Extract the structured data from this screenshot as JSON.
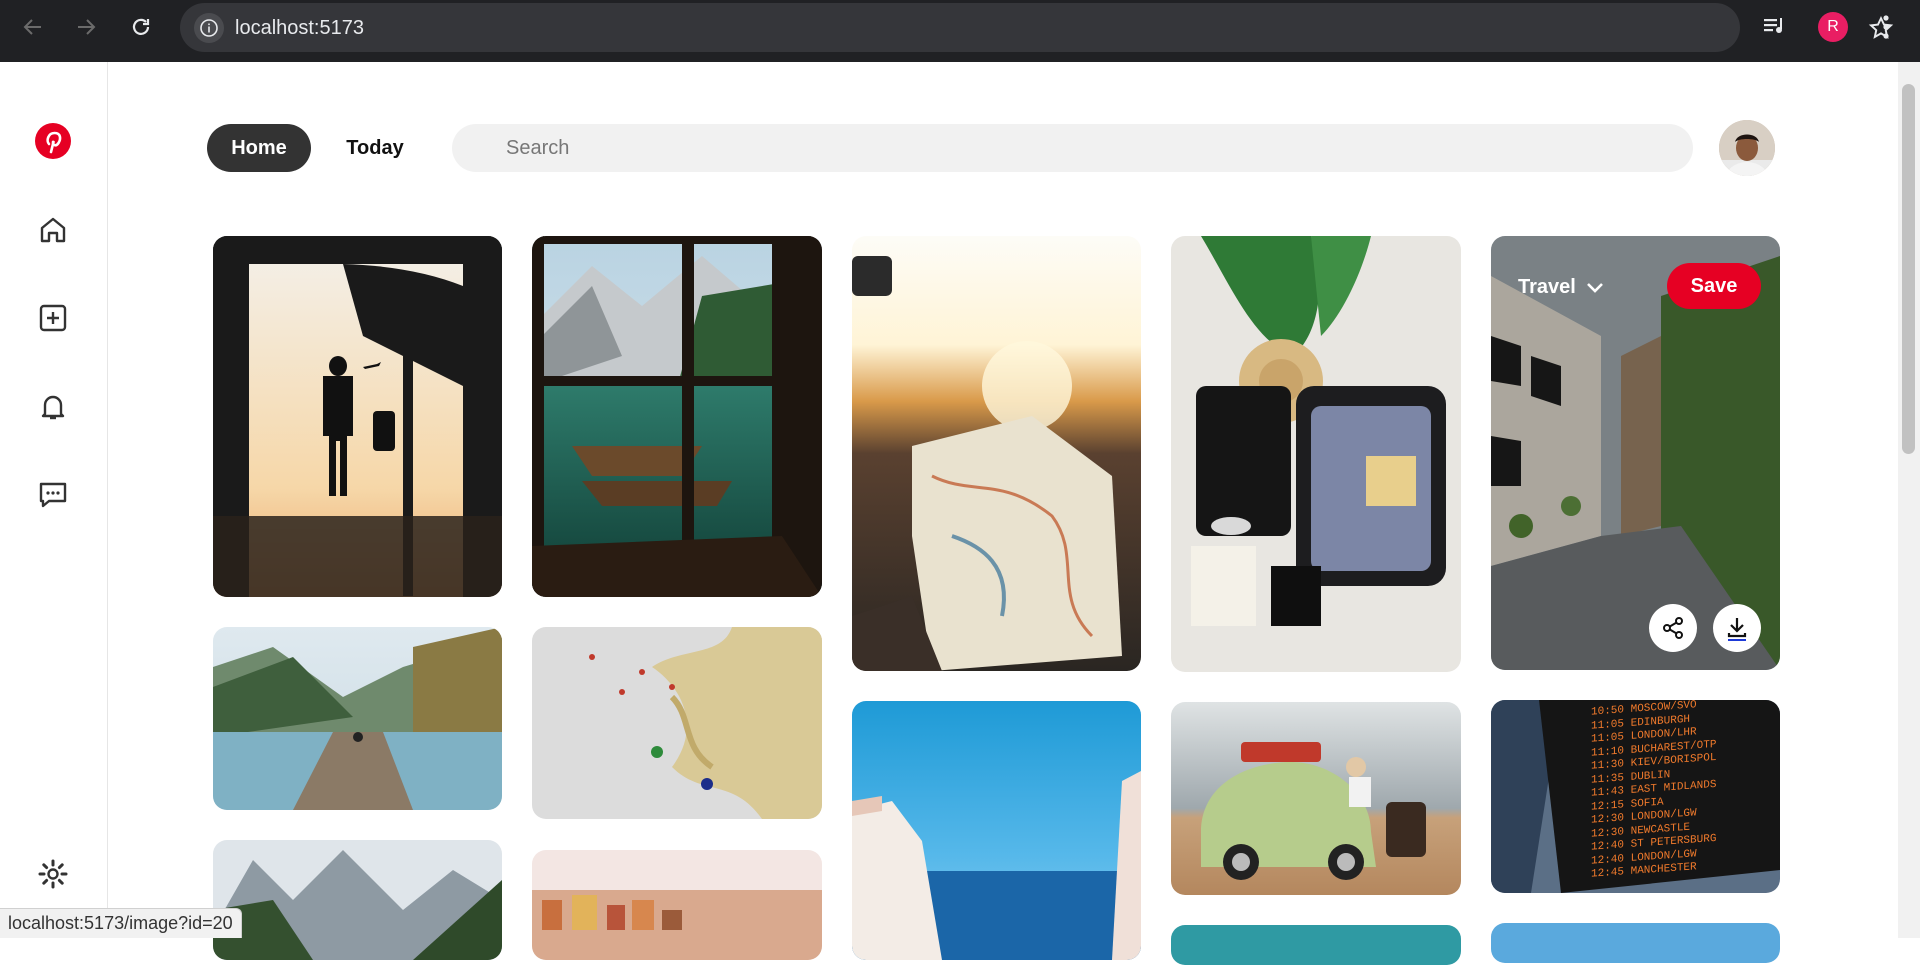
{
  "browser": {
    "url": "localhost:5173",
    "profile_initial": "R",
    "status_url": "localhost:5173/image?id=20"
  },
  "header": {
    "home_label": "Home",
    "today_label": "Today",
    "search_placeholder": "Search"
  },
  "hover_pin": {
    "board_label": "Travel",
    "save_label": "Save"
  },
  "colors": {
    "accent": "#e60023",
    "chrome_bg": "#202124"
  },
  "sidebar": {
    "items": [
      "pinterest-logo",
      "home-icon",
      "create-icon",
      "notifications-icon",
      "messages-icon",
      "settings-icon"
    ]
  },
  "flight_board": {
    "rows": [
      "10:50 MOSCOW/SVO",
      "11:05 EDINBURGH",
      "11:05 LONDON/LHR",
      "11:10 BUCHAREST/OTP",
      "11:30 KIEV/BORISPOL",
      "11:35 DUBLIN",
      "11:43 EAST MIDLANDS",
      "12:15 SOFIA",
      "12:30 LONDON/LGW",
      "12:30 NEWCASTLE",
      "12:40 ST PETERSBURG",
      "12:40 LONDON/LGW",
      "12:45 MANCHESTER"
    ]
  }
}
